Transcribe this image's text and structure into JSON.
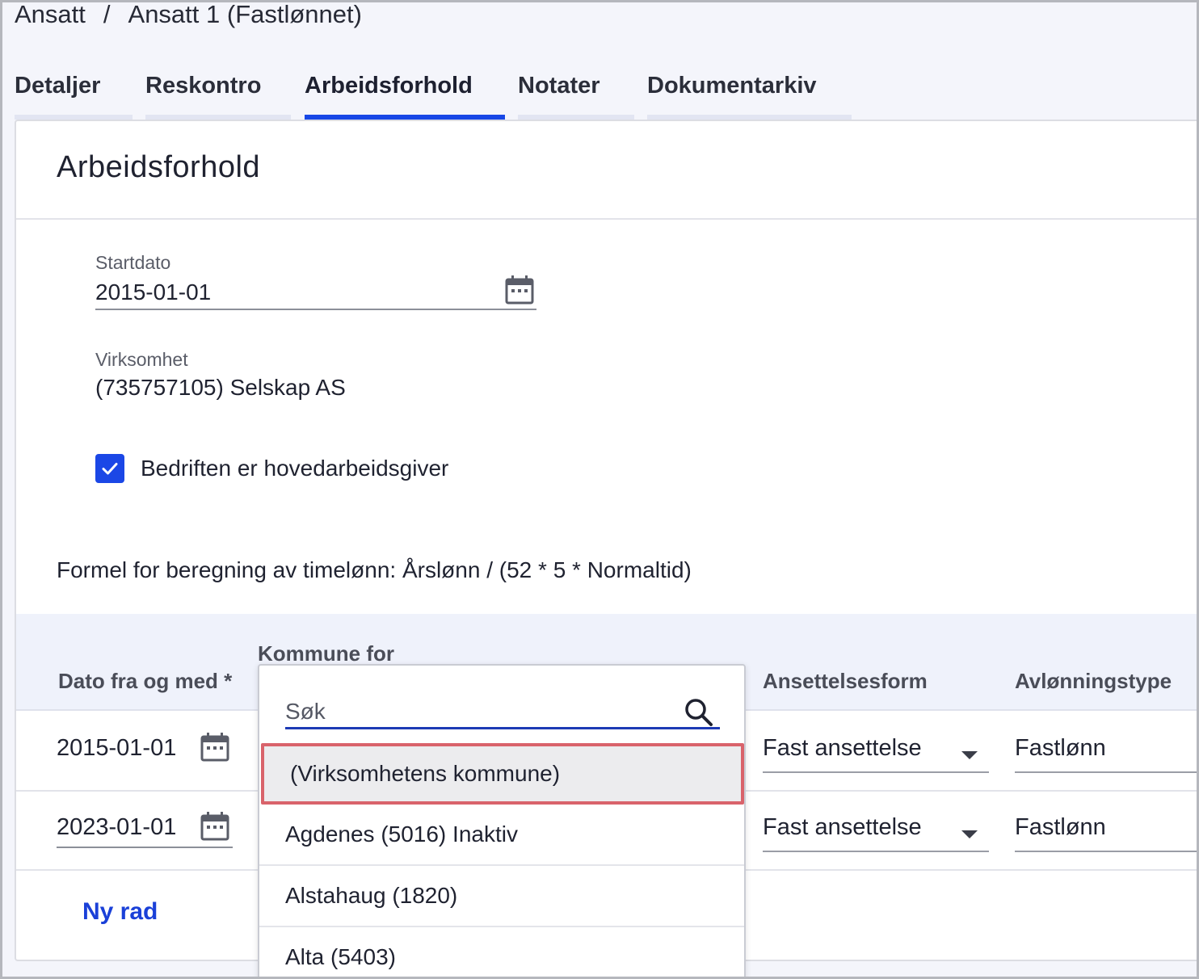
{
  "breadcrumb": {
    "parent": "Ansatt",
    "separator": "/",
    "current": "Ansatt 1 (Fastlønnet)"
  },
  "tabs": [
    {
      "label": "Detaljer",
      "active": false
    },
    {
      "label": "Reskontro",
      "active": false
    },
    {
      "label": "Arbeidsforhold",
      "active": true
    },
    {
      "label": "Notater",
      "active": false
    },
    {
      "label": "Dokumentarkiv",
      "active": false
    }
  ],
  "card": {
    "title": "Arbeidsforhold",
    "startdato": {
      "label": "Startdato",
      "value": "2015-01-01",
      "icon": "calendar-icon"
    },
    "virksomhet": {
      "label": "Virksomhet",
      "value": "(735757105) Selskap AS"
    },
    "hovedarbeidsgiver": {
      "label": "Bedriften er hovedarbeidsgiver",
      "checked": true
    },
    "formula": "Formel for beregning av timelønn: Årslønn / (52 * 5 * Normaltid)"
  },
  "table": {
    "headers": {
      "dato": "Dato fra og med *",
      "kommune": "Kommune for",
      "ansettelsesform": "Ansettelsesform",
      "avlonningstype": "Avlønningstype"
    },
    "rows": [
      {
        "dato": "2015-01-01",
        "ansettelsesform": "Fast ansettelse",
        "avlonningstype": "Fastlønn"
      },
      {
        "dato": "2023-01-01",
        "ansettelsesform": "Fast ansettelse",
        "avlonningstype": "Fastlønn"
      }
    ],
    "add_row_label": "Ny rad"
  },
  "dropdown": {
    "search_placeholder": "Søk",
    "options": [
      {
        "label": "(Virksomhetens kommune)",
        "selected": true
      },
      {
        "label": "Agdenes (5016) Inaktiv",
        "selected": false
      },
      {
        "label": "Alstahaug (1820)",
        "selected": false
      },
      {
        "label": "Alta (5403)",
        "selected": false
      }
    ]
  },
  "colors": {
    "accent": "#1747e6",
    "highlight_border": "#d9636b",
    "link": "#1a40d8"
  }
}
